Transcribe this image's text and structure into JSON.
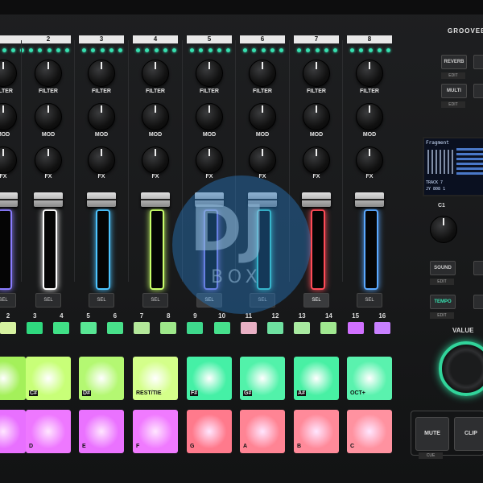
{
  "brand": {
    "text": "GROOVEB"
  },
  "channels": [
    {
      "number": "",
      "fader_color": "#8a7cff",
      "sel_active": false
    },
    {
      "number": "2",
      "fader_color": "#ffffff",
      "sel_active": false
    },
    {
      "number": "3",
      "fader_color": "#4cc4ff",
      "sel_active": false
    },
    {
      "number": "4",
      "fader_color": "#c8ff6a",
      "sel_active": false
    },
    {
      "number": "5",
      "fader_color": "#9a86ff",
      "sel_active": true
    },
    {
      "number": "6",
      "fader_color": "#42e6d6",
      "sel_active": false
    },
    {
      "number": "7",
      "fader_color": "#ff4b57",
      "sel_active": true
    },
    {
      "number": "8",
      "fader_color": "#5aa8ff",
      "sel_active": false
    }
  ],
  "knob_labels": {
    "filter": "FILTER",
    "mod": "MOD",
    "fx": "FX"
  },
  "sel_label": "SEL",
  "steps": [
    {
      "num": "2",
      "color": "#d6f2a0"
    },
    {
      "num": "3",
      "color": "#2fd87e"
    },
    {
      "num": "4",
      "color": "#40e086"
    },
    {
      "num": "5",
      "color": "#58e694"
    },
    {
      "num": "6",
      "color": "#48e08a"
    },
    {
      "num": "7",
      "color": "#b4e89a"
    },
    {
      "num": "8",
      "color": "#9ee88a"
    },
    {
      "num": "9",
      "color": "#3ed88c"
    },
    {
      "num": "10",
      "color": "#46e08c"
    },
    {
      "num": "11",
      "color": "#e8b0c4"
    },
    {
      "num": "12",
      "color": "#6ee0a0"
    },
    {
      "num": "13",
      "color": "#a8eaa0"
    },
    {
      "num": "14",
      "color": "#a0e890"
    },
    {
      "num": "15",
      "color": "#d070ff"
    },
    {
      "num": "16",
      "color": "#c880ff"
    }
  ],
  "pads_top": [
    {
      "label": "",
      "color": "#a4f05a",
      "boxed": false
    },
    {
      "label": "C#",
      "color": "#c8ff78",
      "boxed": true
    },
    {
      "label": "D#",
      "color": "#b4f872",
      "boxed": true
    },
    {
      "label": "REST/TIE",
      "color": "#d4ff8a",
      "boxed": false
    },
    {
      "label": "F#",
      "color": "#45f0a6",
      "boxed": true
    },
    {
      "label": "G#",
      "color": "#52f2aa",
      "boxed": true
    },
    {
      "label": "A#",
      "color": "#48f0a4",
      "boxed": true
    },
    {
      "label": "OCT+",
      "color": "#5af2ae",
      "boxed": false
    }
  ],
  "pads_bottom": [
    {
      "label": "",
      "color": "#e870ff"
    },
    {
      "label": "D",
      "color": "#ee78ff"
    },
    {
      "label": "E",
      "color": "#ea72ff"
    },
    {
      "label": "F",
      "color": "#f07aff"
    },
    {
      "label": "G",
      "color": "#ff7a8c"
    },
    {
      "label": "A",
      "color": "#ff8494"
    },
    {
      "label": "B",
      "color": "#ff8a9a"
    },
    {
      "label": "C",
      "color": "#ff92a0"
    }
  ],
  "right": {
    "reverb": "REVERB",
    "multi": "MULTI",
    "edit": "EDIT",
    "screen_title": "Fragment",
    "screen_footer1": "TRACK 7",
    "screen_footer2": "JY 808 1",
    "c1": "C1",
    "sound": "SOUND",
    "tempo": "TEMPO",
    "value": "VALUE",
    "mute": "MUTE",
    "clip": "CLIP",
    "cue": "CUE"
  },
  "watermark": {
    "dj": "DJ",
    "box": "BOX"
  }
}
